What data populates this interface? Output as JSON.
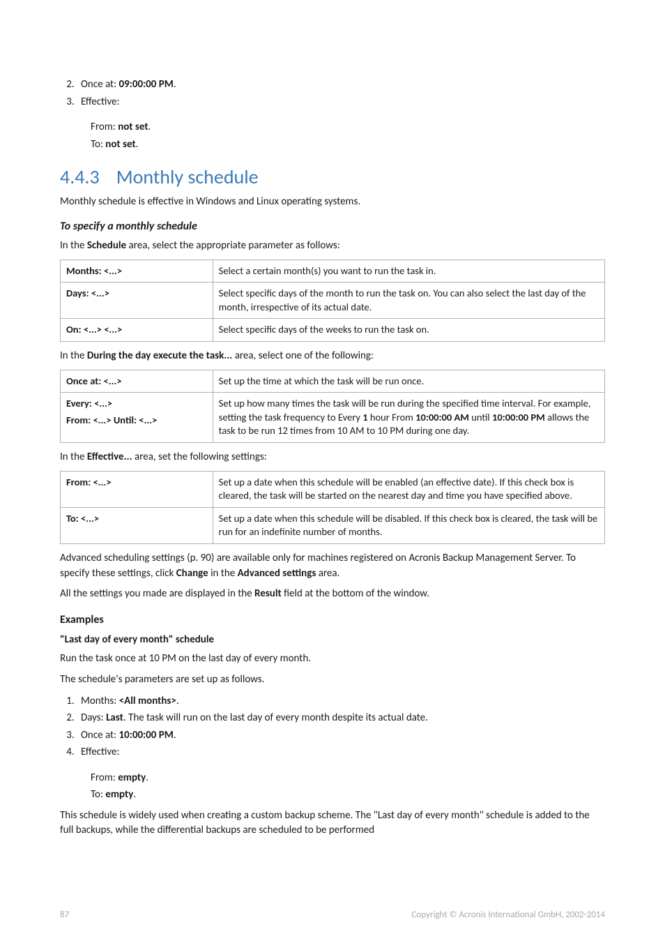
{
  "intro_list": {
    "item2": {
      "num": "2.",
      "prefix": "Once at: ",
      "val": "09:00:00 PM",
      "suffix": "."
    },
    "item3": {
      "num": "3.",
      "text": "Effective:"
    },
    "sub_from": {
      "prefix": "From: ",
      "val": "not set",
      "suffix": "."
    },
    "sub_to": {
      "prefix": "To: ",
      "val": "not set",
      "suffix": "."
    }
  },
  "section": {
    "number": "4.4.3",
    "title": "Monthly schedule"
  },
  "p_intro": "Monthly schedule is effective in Windows and Linux operating systems.",
  "h_specify": "To specify a monthly schedule",
  "p_schedule_lead": {
    "a": "In the ",
    "b": "Schedule",
    "c": " area, select the appropriate parameter as follows:"
  },
  "table1": {
    "r1": {
      "label": "Months: <...>",
      "desc": "Select a certain month(s) you want to run the task in."
    },
    "r2": {
      "label": "Days: <...>",
      "desc": "Select specific days of the month to run the task on. You can also select the last day of the month, irrespective of its actual date."
    },
    "r3": {
      "label": "On: <...> <...>",
      "desc": "Select specific days of the weeks to run the task on."
    }
  },
  "p_during_lead": {
    "a": "In the ",
    "b": "During the day execute the task...",
    "c": " area, select one of the following:"
  },
  "table2": {
    "r1": {
      "label": "Once at: <...>",
      "desc": "Set up the time at which the task will be run once."
    },
    "r2": {
      "label1": "Every: <...>",
      "label2": "From: <...> Until: <...>",
      "desc_a": "Set up how many times the task will be run during the specified time interval. For example, setting the task frequency to Every ",
      "desc_b": "1",
      "desc_c": " hour From ",
      "desc_d": "10:00:00 AM",
      "desc_e": " until ",
      "desc_f": "10:00:00 PM",
      "desc_g": " allows the task to be run 12 times from 10 AM to 10 PM during one day."
    }
  },
  "p_effective_lead": {
    "a": "In the ",
    "b": "Effective...",
    "c": " area, set the following settings:"
  },
  "table3": {
    "r1": {
      "label": "From: <...>",
      "desc": "Set up a date when this schedule will be enabled (an effective date). If this check box is cleared, the task will be started on the nearest day and time you have specified above."
    },
    "r2": {
      "label": "To: <...>",
      "desc": "Set up a date when this schedule will be disabled. If this check box is cleared, the task will be run for an indefinite number of months."
    }
  },
  "p_adv": {
    "a": "Advanced scheduling settings (p. 90) are available only for machines registered on Acronis Backup Management Server. To specify these settings, click ",
    "b": "Change",
    "c": " in the ",
    "d": "Advanced settings",
    "e": " area."
  },
  "p_result": {
    "a": "All the settings you made are displayed in the ",
    "b": "Result",
    "c": " field at the bottom of the window."
  },
  "h_examples": "Examples",
  "h_lastday": "\"Last day of every month\" schedule",
  "p_lastday1": "Run the task once at 10 PM on the last day of every month.",
  "p_lastday2": "The schedule's parameters are set up as follows.",
  "example_list": {
    "i1": {
      "prefix": "Months: ",
      "val": "<All months>",
      "suffix": "."
    },
    "i2": {
      "prefix": "Days: ",
      "val": "Last",
      "suffix": ". The task will run on the last day of every month despite its actual date."
    },
    "i3": {
      "prefix": "Once at: ",
      "val": "10:00:00 PM",
      "suffix": "."
    },
    "i4": {
      "text": "Effective:"
    },
    "sub_from": {
      "prefix": "From: ",
      "val": "empty",
      "suffix": "."
    },
    "sub_to": {
      "prefix": "To: ",
      "val": "empty",
      "suffix": "."
    }
  },
  "p_closing": "This schedule is widely used when creating a custom backup scheme. The \"Last day of every month\" schedule is added to the full backups, while the differential backups are scheduled to be performed",
  "footer": {
    "page": "87",
    "copyright": "Copyright © Acronis International GmbH, 2002-2014"
  }
}
